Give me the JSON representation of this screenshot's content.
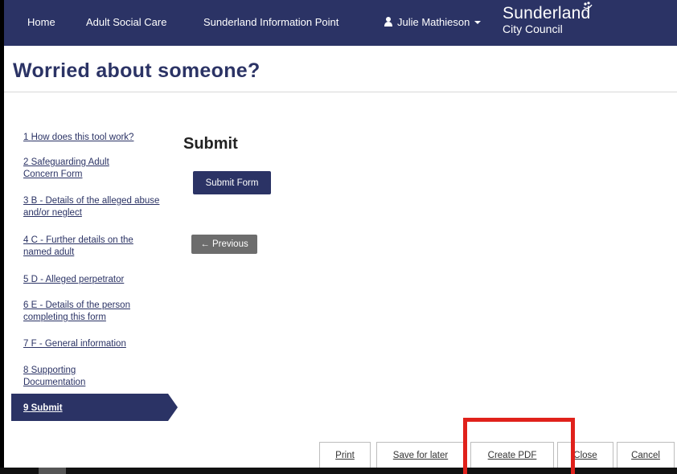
{
  "nav": {
    "home": "Home",
    "adult_social_care": "Adult Social Care",
    "sunderland_info_point": "Sunderland Information Point",
    "user_name": "Julie Mathieson",
    "user_icon": "person-icon",
    "logo_main": "Sunderland",
    "logo_sub": "City Council"
  },
  "page": {
    "title": "Worried about someone?"
  },
  "steps": [
    {
      "num": "1",
      "label": "How does this tool work?"
    },
    {
      "num": "2",
      "label": "Safeguarding Adult Concern Form"
    },
    {
      "num": "3",
      "label": "B - Details of the alleged abuse and/or neglect"
    },
    {
      "num": "4",
      "label": "C - Further details on the named adult"
    },
    {
      "num": "5",
      "label": "D - Alleged perpetrator"
    },
    {
      "num": "6",
      "label": "E - Details of the person completing this form"
    },
    {
      "num": "7",
      "label": "F - General information"
    },
    {
      "num": "8",
      "label": "Supporting Documentation"
    },
    {
      "num": "9",
      "label": "Submit",
      "active": true
    }
  ],
  "main": {
    "section_title": "Submit",
    "submit_label": "Submit Form",
    "previous_label": "Previous",
    "previous_icon": "arrow-left-icon"
  },
  "footer": {
    "print": "Print",
    "save_for_later": "Save for later",
    "create_pdf": "Create PDF",
    "close": "Close",
    "cancel": "Cancel"
  },
  "colors": {
    "brand": "#2b3365",
    "highlight": "#e0211b",
    "secondary_button": "#6d6d6d"
  }
}
